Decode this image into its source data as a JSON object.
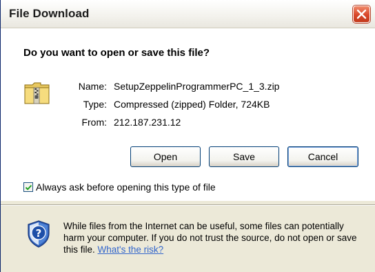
{
  "window": {
    "title": "File Download",
    "close_icon": "close-x-icon"
  },
  "prompt": {
    "question": "Do you want to open or save this file?"
  },
  "file": {
    "icon": "zip-folder-icon",
    "name_label": "Name:",
    "name_value": "SetupZeppelinProgrammerPC_1_3.zip",
    "type_label": "Type:",
    "type_value": "Compressed (zipped) Folder, 724KB",
    "from_label": "From:",
    "from_value": "212.187.231.12"
  },
  "buttons": {
    "open": "Open",
    "save": "Save",
    "cancel": "Cancel"
  },
  "options": {
    "always_ask_label": "Always ask before opening this type of file",
    "always_ask_checked": true
  },
  "warning": {
    "icon": "shield-question-icon",
    "text": "While files from the Internet can be useful, some files can potentially harm your computer. If you do not trust the source, do not open or save this file. ",
    "link": "What's the risk?"
  },
  "colors": {
    "dialog_bg": "#ece9d8",
    "content_bg": "#ffffff",
    "close_button": "#d9462a",
    "link": "#3366cc",
    "button_border": "#003c74"
  }
}
